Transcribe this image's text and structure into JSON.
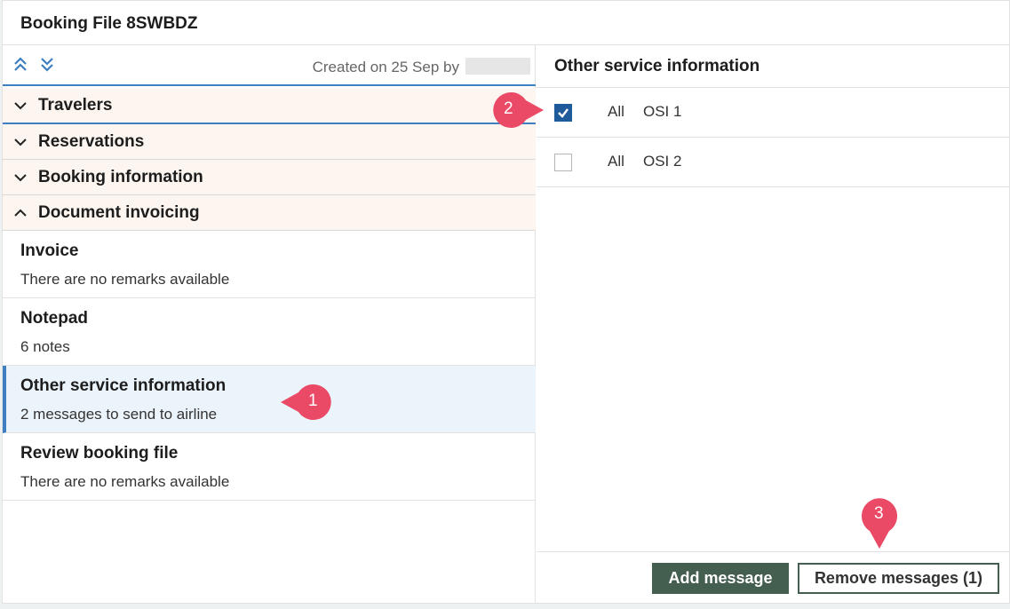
{
  "header": {
    "title": "Booking File 8SWBDZ"
  },
  "left": {
    "toolbar": {
      "expand_icon": "chevrons-up-icon",
      "collapse_icon": "chevrons-down-icon",
      "created_text": "Created on 25 Sep by"
    },
    "sections": [
      {
        "label": "Travelers",
        "state": "collapsed"
      },
      {
        "label": "Reservations",
        "state": "collapsed"
      },
      {
        "label": "Booking information",
        "state": "collapsed"
      },
      {
        "label": "Document invoicing",
        "state": "expanded"
      }
    ],
    "items": [
      {
        "title": "Invoice",
        "subtitle": "There are no remarks available"
      },
      {
        "title": "Notepad",
        "subtitle": "6 notes"
      },
      {
        "title": "Other service information",
        "subtitle": "2 messages to send to airline"
      },
      {
        "title": "Review booking file",
        "subtitle": "There are no remarks available"
      }
    ]
  },
  "right": {
    "title": "Other service information",
    "rows": [
      {
        "scope": "All",
        "name": "OSI 1",
        "checked": true
      },
      {
        "scope": "All",
        "name": "OSI 2",
        "checked": false
      }
    ],
    "buttons": {
      "add": "Add message",
      "remove": "Remove messages (1)"
    }
  },
  "markers": [
    "1",
    "2",
    "3"
  ],
  "colors": {
    "accent": "#3d7fc1",
    "primary_button": "#445e50",
    "marker": "#ea4a66",
    "section_bg": "#fdf6f0",
    "active_bg": "#ebf3fb"
  }
}
